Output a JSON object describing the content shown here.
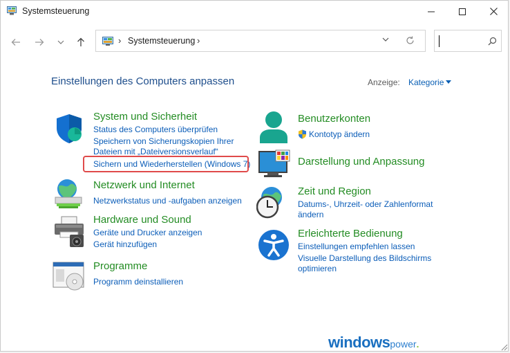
{
  "window": {
    "title": "Systemsteuerung"
  },
  "address_bar": {
    "separator": "›",
    "crumb": "Systemsteuerung",
    "search_value": ""
  },
  "header": {
    "title": "Einstellungen des Computers anpassen",
    "view_label": "Anzeige:",
    "view_value": "Kategorie"
  },
  "categories": [
    {
      "title": "System und Sicherheit",
      "icon": "shield-icon",
      "links": [
        "Status des Computers überprüfen",
        "Speichern von Sicherungskopien Ihrer",
        "Dateien mit „Dateiversionsverlauf“",
        "Sichern und Wiederherstellen (Windows 7)"
      ]
    },
    {
      "title": "Netzwerk und Internet",
      "icon": "globe-network-icon",
      "links": [
        "Netzwerkstatus und -aufgaben anzeigen"
      ]
    },
    {
      "title": "Hardware und Sound",
      "icon": "printer-icon",
      "links": [
        "Geräte und Drucker anzeigen",
        "Gerät hinzufügen"
      ]
    },
    {
      "title": "Programme",
      "icon": "programs-icon",
      "links": [
        "Programm deinstallieren"
      ]
    },
    {
      "title": "Benutzerkonten",
      "icon": "user-icon",
      "links": [
        "Kontotyp ändern"
      ]
    },
    {
      "title": "Darstellung und Anpassung",
      "icon": "monitor-icon",
      "links": []
    },
    {
      "title": "Zeit und Region",
      "icon": "clock-globe-icon",
      "links": [
        "Datums-, Uhrzeit- oder Zahlenformat",
        "ändern"
      ]
    },
    {
      "title": "Erleichterte Bedienung",
      "icon": "accessibility-icon",
      "links": [
        "Einstellungen empfehlen lassen",
        "Visuelle Darstellung des Bildschirms",
        "optimieren"
      ]
    }
  ],
  "watermark": {
    "main": "windows",
    "small": "power",
    "dot": "."
  },
  "colors": {
    "link": "#0b5db8",
    "category": "#238c23",
    "title": "#1e4e8c",
    "highlight": "#e04a4a"
  }
}
